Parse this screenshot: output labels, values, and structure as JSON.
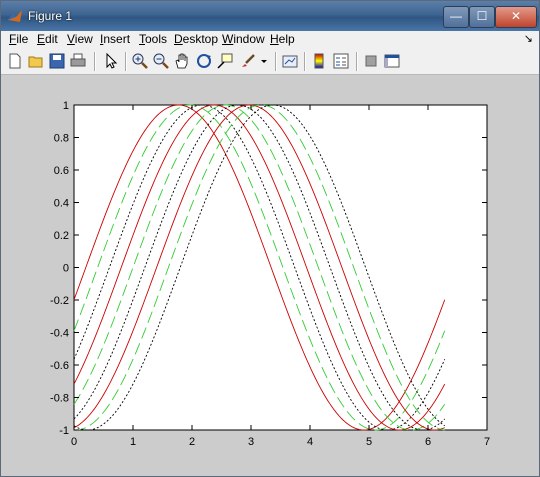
{
  "window": {
    "title": "Figure 1",
    "buttons": {
      "minimize": "—",
      "maximize": "☐",
      "close": "✕"
    }
  },
  "menu": {
    "items": [
      {
        "key": "F",
        "rest": "ile"
      },
      {
        "key": "E",
        "rest": "dit"
      },
      {
        "key": "V",
        "rest": "iew"
      },
      {
        "key": "I",
        "rest": "nsert"
      },
      {
        "key": "T",
        "rest": "ools"
      },
      {
        "key": "D",
        "rest": "esktop"
      },
      {
        "key": "W",
        "rest": "indow"
      },
      {
        "key": "H",
        "rest": "elp"
      }
    ],
    "dock_arrow": "↘"
  },
  "toolbar": {
    "icons": [
      "new-figure-icon",
      "open-file-icon",
      "save-icon",
      "print-icon",
      "edit-plot-icon",
      "zoom-in-icon",
      "zoom-out-icon",
      "pan-hand-icon",
      "rotate-3d-icon",
      "data-cursor-icon",
      "brush-icon",
      "brush-dropdown-icon",
      "link-plot-icon",
      "colorbar-icon",
      "legend-icon",
      "hide-plot-tools-icon",
      "show-plot-tools-icon"
    ]
  },
  "colors": {
    "red": "#cc0000",
    "green": "#33cc33",
    "black": "#000000",
    "figure_bg": "#cccccc",
    "axes_bg": "#ffffff"
  },
  "chart_data": {
    "type": "line",
    "xlim": [
      0,
      7
    ],
    "ylim": [
      -1,
      1
    ],
    "x_ticks": [
      "0",
      "1",
      "2",
      "3",
      "4",
      "5",
      "6",
      "7"
    ],
    "y_ticks": [
      "1",
      "0.8",
      "0.6",
      "0.4",
      "0.2",
      "0",
      "-0.2",
      "-0.4",
      "-0.6",
      "-0.8",
      "-1"
    ],
    "grid": false,
    "x_range_of_curves": [
      0,
      6.2832
    ],
    "function": "sin(x - phase)",
    "series": [
      {
        "style": "solid",
        "color": "red",
        "phase": 0.2
      },
      {
        "style": "dashed",
        "color": "green",
        "phase": 0.4
      },
      {
        "style": "dotted",
        "color": "black",
        "phase": 0.6
      },
      {
        "style": "solid",
        "color": "red",
        "phase": 0.8
      },
      {
        "style": "dashed",
        "color": "green",
        "phase": 1.0
      },
      {
        "style": "dotted",
        "color": "black",
        "phase": 1.2
      },
      {
        "style": "solid",
        "color": "red",
        "phase": 1.4
      },
      {
        "style": "dashed",
        "color": "green",
        "phase": 1.6
      },
      {
        "style": "dotted",
        "color": "black",
        "phase": 1.8
      }
    ]
  }
}
